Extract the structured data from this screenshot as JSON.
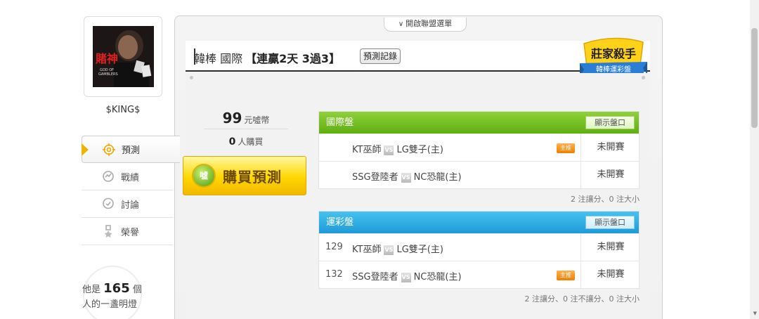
{
  "user": {
    "name": "$KING$"
  },
  "nav": [
    {
      "label": "預測",
      "icon": "target-icon",
      "active": true
    },
    {
      "label": "戰績",
      "icon": "record-icon",
      "active": false
    },
    {
      "label": "討論",
      "icon": "discussion-icon",
      "active": false
    },
    {
      "label": "榮譽",
      "icon": "honor-medal-icon",
      "active": false
    }
  ],
  "light": {
    "prefix": "他是",
    "count": "165",
    "suffix": "個",
    "line2": "人的一盞明燈"
  },
  "league_menu": {
    "label": "開啟聯盟選單"
  },
  "header": {
    "title": "韓棒 國際",
    "streak": "【連贏2天 3過3】",
    "record_button": "預測記錄",
    "badge_title": "莊家殺手",
    "badge_subtitle": "韓棒運彩盤"
  },
  "purchase": {
    "price": "99",
    "price_unit": "元噓幣",
    "buyers": "0",
    "buyers_unit": "人購買",
    "buy_button": "購買預測",
    "coin_label": "噓"
  },
  "markets": {
    "international": {
      "title": "國際盤",
      "show_button": "顯示盤口",
      "summary": "2 注讓分、0 注大小",
      "games": [
        {
          "id": "",
          "away": "KT巫師",
          "vs": "VS",
          "home": "LG雙子(主)",
          "tag": "主推",
          "status": "未開賽"
        },
        {
          "id": "",
          "away": "SSG登陸者",
          "vs": "VS",
          "home": "NC恐龍(主)",
          "tag": "",
          "status": "未開賽"
        }
      ]
    },
    "lottery": {
      "title": "運彩盤",
      "show_button": "顯示盤口",
      "summary": "2 注讓分、0 注不讓分、0 注大小",
      "games": [
        {
          "id": "129",
          "away": "KT巫師",
          "vs": "VS",
          "home": "LG雙子(主)",
          "tag": "",
          "status": "未開賽"
        },
        {
          "id": "132",
          "away": "SSG登陸者",
          "vs": "VS",
          "home": "NC恐龍(主)",
          "tag": "主推",
          "status": "未開賽"
        }
      ]
    }
  }
}
